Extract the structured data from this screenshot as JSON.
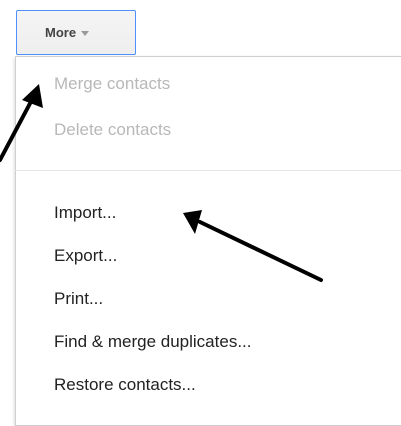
{
  "toolbar": {
    "more_label": "More"
  },
  "menu": {
    "items": [
      {
        "label": "Merge contacts",
        "enabled": false
      },
      {
        "label": "Delete contacts",
        "enabled": false
      },
      {
        "label": "Import...",
        "enabled": true
      },
      {
        "label": "Export...",
        "enabled": true
      },
      {
        "label": "Print...",
        "enabled": true
      },
      {
        "label": "Find & merge duplicates...",
        "enabled": true
      },
      {
        "label": "Restore contacts...",
        "enabled": true
      }
    ]
  },
  "colors": {
    "button_border": "#4d90fe",
    "disabled_text": "#b8b8b8",
    "enabled_text": "#222222",
    "annotation_arrow": "#000000"
  }
}
